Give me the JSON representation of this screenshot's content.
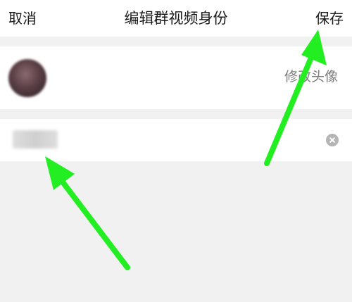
{
  "nav": {
    "cancel_label": "取消",
    "title": "编辑群视频身份",
    "save_label": "保存"
  },
  "avatar_row": {
    "action_label": "修改头像"
  },
  "name_row": {
    "value": "",
    "clear_icon": "clear-icon"
  },
  "annotations": {
    "arrow_color": "#22ee22",
    "arrows": [
      "arrow-to-save",
      "arrow-to-name-field"
    ]
  },
  "colors": {
    "background": "#f1f1f1",
    "surface": "#ffffff",
    "text_primary": "#1a1a1a",
    "text_secondary": "#7d7d7d"
  }
}
